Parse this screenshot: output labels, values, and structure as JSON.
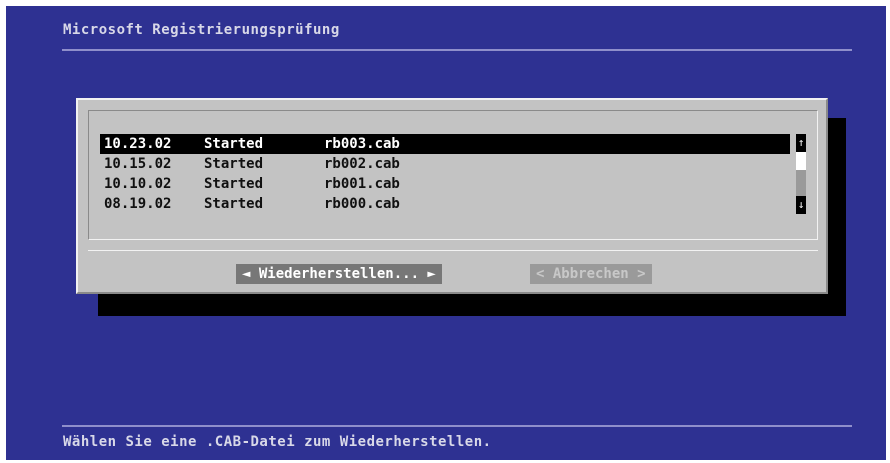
{
  "window": {
    "title": "Microsoft Registrierungsprüfung",
    "status_text": "Wählen Sie eine .CAB-Datei zum Wiederherstellen."
  },
  "list": {
    "rows": [
      {
        "date": "10.23.02",
        "status": "Started",
        "file": "rb003.cab",
        "selected": true
      },
      {
        "date": "10.15.02",
        "status": "Started",
        "file": "rb002.cab",
        "selected": false
      },
      {
        "date": "10.10.02",
        "status": "Started",
        "file": "rb001.cab",
        "selected": false
      },
      {
        "date": "08.19.02",
        "status": "Started",
        "file": "rb000.cab",
        "selected": false
      }
    ]
  },
  "scrollbar": {
    "up_icon": "arrow-up-icon",
    "down_icon": "arrow-down-icon",
    "up_glyph": "↑",
    "down_glyph": "↓"
  },
  "buttons": {
    "restore_label": "◄ Wiederherstellen... ►",
    "cancel_label": "< Abbrechen >"
  },
  "colors": {
    "background": "#2e3192",
    "dialog": "#c3c3c3",
    "selection": "#000000"
  }
}
